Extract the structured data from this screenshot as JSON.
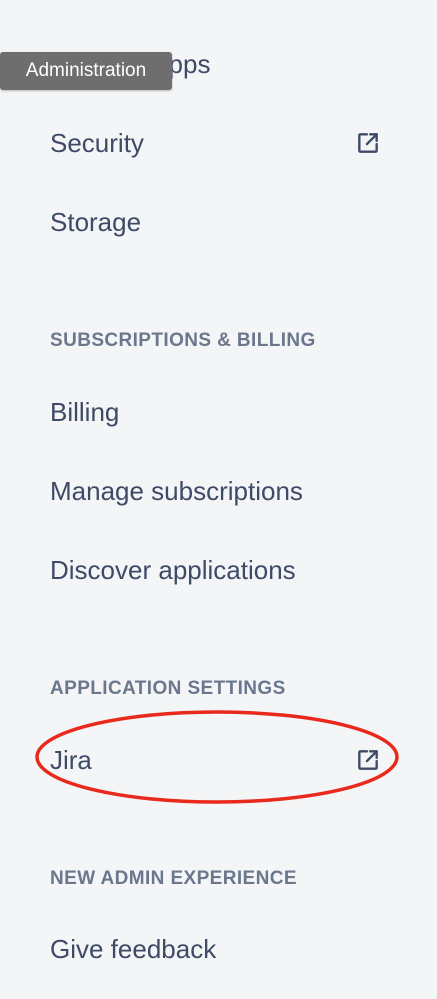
{
  "tooltip": {
    "text": "Administration"
  },
  "nav": {
    "installed_apps_label": "Installed apps",
    "security_label": "Security",
    "storage_label": "Storage"
  },
  "subscriptions_billing": {
    "heading": "SUBSCRIPTIONS & BILLING",
    "items": [
      {
        "label": "Billing"
      },
      {
        "label": "Manage subscriptions"
      },
      {
        "label": "Discover applications"
      }
    ]
  },
  "application_settings": {
    "heading": "APPLICATION SETTINGS",
    "items": [
      {
        "label": "Jira",
        "external": true
      }
    ]
  },
  "new_admin_experience": {
    "heading": "NEW ADMIN EXPERIENCE",
    "items": [
      {
        "label": "Give feedback"
      }
    ]
  },
  "icons": {
    "external_link": "external-link-icon"
  },
  "colors": {
    "background": "#f4f5f7",
    "nav_text": "#3e4a66",
    "heading_text": "#6b778c",
    "tooltip_bg": "#6e6e6e",
    "annotation": "#e8291c"
  }
}
